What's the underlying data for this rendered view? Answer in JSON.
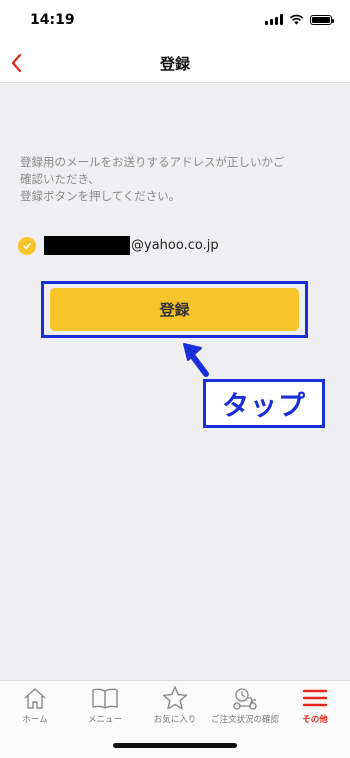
{
  "status_bar": {
    "time": "14:19"
  },
  "nav": {
    "title": "登録"
  },
  "instructions": "登録用のメールをお送りするアドレスが正しいかご\n確認いただき、\n登録ボタンを押してください。",
  "email": {
    "domain": "@yahoo.co.jp"
  },
  "register_button": {
    "label": "登録"
  },
  "annotation": {
    "label": "タップ"
  },
  "tab_bar": {
    "items": [
      {
        "label": "ホーム",
        "icon": "home-icon"
      },
      {
        "label": "メニュー",
        "icon": "menu-book-icon"
      },
      {
        "label": "お気に入り",
        "icon": "star-icon"
      },
      {
        "label": "ご注文状況の確認",
        "icon": "delivery-scooter-icon"
      },
      {
        "label": "その他",
        "icon": "hamburger-icon"
      }
    ],
    "active_index": 4
  },
  "colors": {
    "accent_red": "#e0261d",
    "button_yellow": "#f7c42a",
    "annotation_blue": "#1a2fd8",
    "background": "#efeff2"
  }
}
